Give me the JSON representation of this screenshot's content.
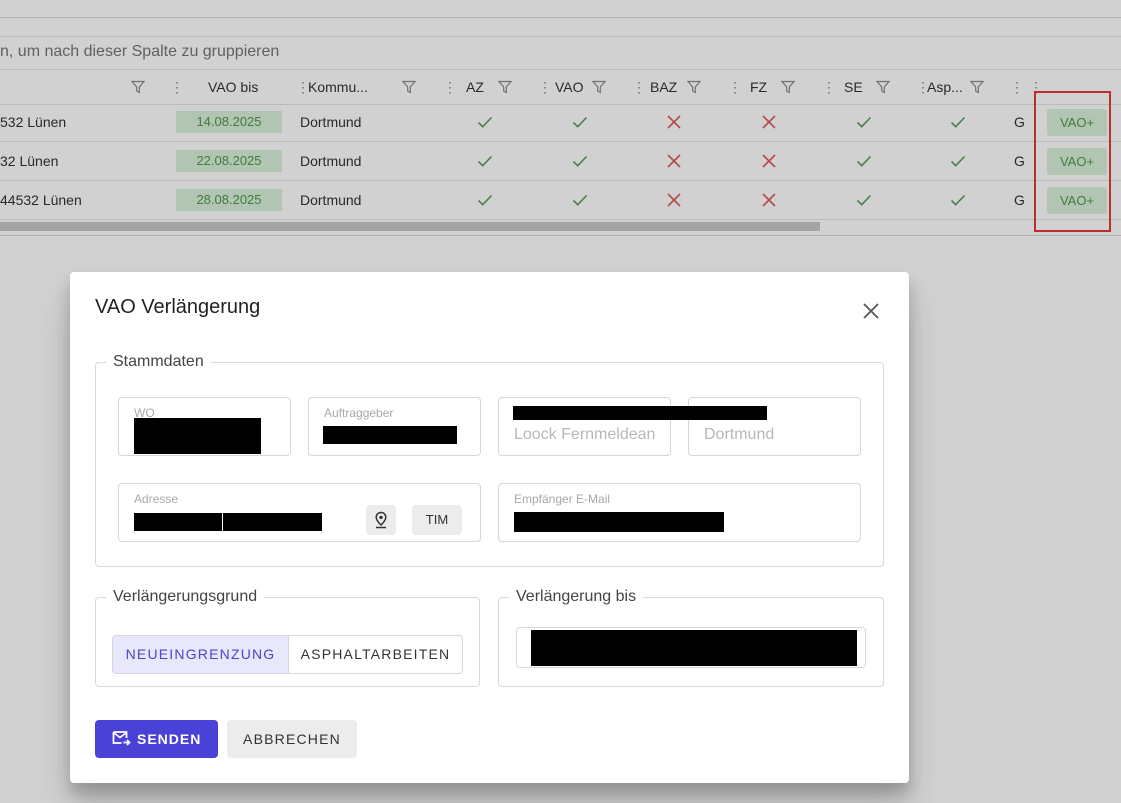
{
  "grid": {
    "group_hint": "n, um nach dieser Spalte zu gruppieren",
    "columns": [
      "VAO bis",
      "Kommu...",
      "AZ",
      "VAO",
      "BAZ",
      "FZ",
      "SE",
      "Asp..."
    ],
    "rows": [
      {
        "address": "532 Lünen",
        "vao_bis": "14.08.2025",
        "kommune": "Dortmund",
        "az": "check",
        "vao": "check",
        "baz": "cross",
        "fz": "cross",
        "se": "check",
        "asp": "check",
        "next": "G",
        "action": "VAO+"
      },
      {
        "address": "32 Lünen",
        "vao_bis": "22.08.2025",
        "kommune": "Dortmund",
        "az": "check",
        "vao": "check",
        "baz": "cross",
        "fz": "cross",
        "se": "check",
        "asp": "check",
        "next": "G",
        "action": "VAO+"
      },
      {
        "address": "44532 Lünen",
        "vao_bis": "28.08.2025",
        "kommune": "Dortmund",
        "az": "check",
        "vao": "check",
        "baz": "cross",
        "fz": "cross",
        "se": "check",
        "asp": "check",
        "next": "G",
        "action": "VAO+"
      }
    ]
  },
  "dialog": {
    "title": "VAO Verlängerung",
    "stammdaten": {
      "legend": "Stammdaten",
      "wo_label": "WO",
      "auftraggeber_label": "Auftraggeber",
      "company_value": "Loock Fernmeldeanlagen",
      "city_value": "Dortmund",
      "adresse_label": "Adresse",
      "tim_button": "TIM",
      "email_label": "Empfänger E-Mail"
    },
    "reason": {
      "legend": "Verlängerungsgrund",
      "options": [
        "NEUEINGRENZUNG",
        "ASPHALTARBEITEN"
      ],
      "selected": "NEUEINGRENZUNG"
    },
    "until": {
      "legend": "Verlängerung bis"
    },
    "buttons": {
      "send": "SENDEN",
      "cancel": "ABBRECHEN"
    }
  },
  "colors": {
    "primary": "#4a42d6",
    "success": "#4c9a4c",
    "success_bg": "#d9efd9",
    "error": "#e53935",
    "check_icon": "#5a9e5a",
    "cross_icon": "#e05a5a"
  },
  "icons": [
    "filter-icon",
    "column-menu-icon",
    "check-icon",
    "cross-icon",
    "close-icon",
    "location-pin-icon",
    "send-mail-icon"
  ]
}
